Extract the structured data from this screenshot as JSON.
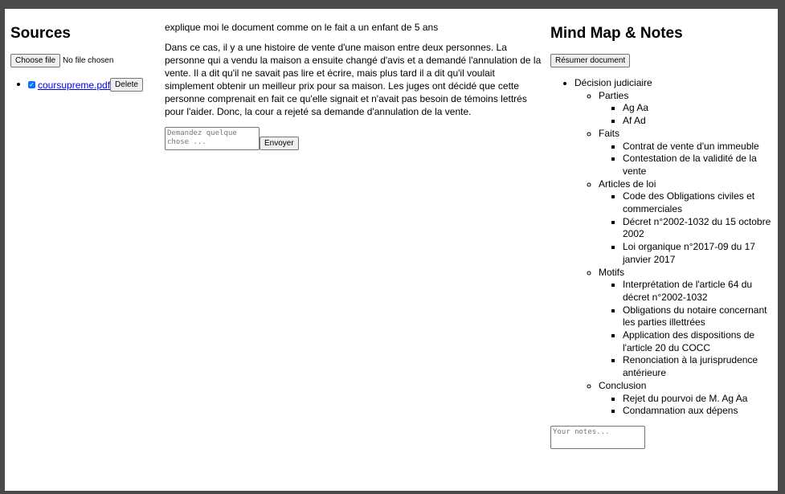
{
  "sources": {
    "title": "Sources",
    "choose_file_label": "Choose file",
    "file_status": "No file chosen",
    "files": [
      {
        "name": "coursupreme.pdf",
        "checked": true,
        "delete_label": "Delete"
      }
    ]
  },
  "chat": {
    "question": "explique moi le document comme on le fait a un enfant de 5 ans",
    "answer": "Dans ce cas, il y a une histoire de vente d'une maison entre deux personnes. La personne qui a vendu la maison a ensuite changé d'avis et a demandé l'annulation de la vente. Il a dit qu'il ne savait pas lire et écrire, mais plus tard il a dit qu'il voulait simplement obtenir un meilleur prix pour sa maison. Les juges ont décidé que cette personne comprenait en fait ce qu'elle signait et n'avait pas besoin de témoins lettrés pour l'aider. Donc, la cour a rejeté sa demande d'annulation de la vente.",
    "input_placeholder": "Demandez quelque chose ...",
    "send_label": "Envoyer"
  },
  "mindmap": {
    "title": "Mind Map & Notes",
    "summarize_label": "Résumer document",
    "root": "Décision judiciaire",
    "branches": [
      {
        "label": "Parties",
        "items": [
          "Ag Aa",
          "Af Ad"
        ]
      },
      {
        "label": "Faits",
        "items": [
          "Contrat de vente d'un immeuble",
          "Contestation de la validité de la vente"
        ]
      },
      {
        "label": "Articles de loi",
        "items": [
          "Code des Obligations civiles et commerciales",
          "Décret n°2002-1032 du 15 octobre 2002",
          "Loi organique n°2017-09 du 17 janvier 2017"
        ]
      },
      {
        "label": "Motifs",
        "items": [
          "Interprétation de l'article 64 du décret n°2002-1032",
          "Obligations du notaire concernant les parties illettrées",
          "Application des dispositions de l'article 20 du COCC",
          "Renonciation à la jurisprudence antérieure"
        ]
      },
      {
        "label": "Conclusion",
        "items": [
          "Rejet du pourvoi de M. Ag Aa",
          "Condamnation aux dépens"
        ]
      }
    ],
    "notes_placeholder": "Your notes..."
  }
}
